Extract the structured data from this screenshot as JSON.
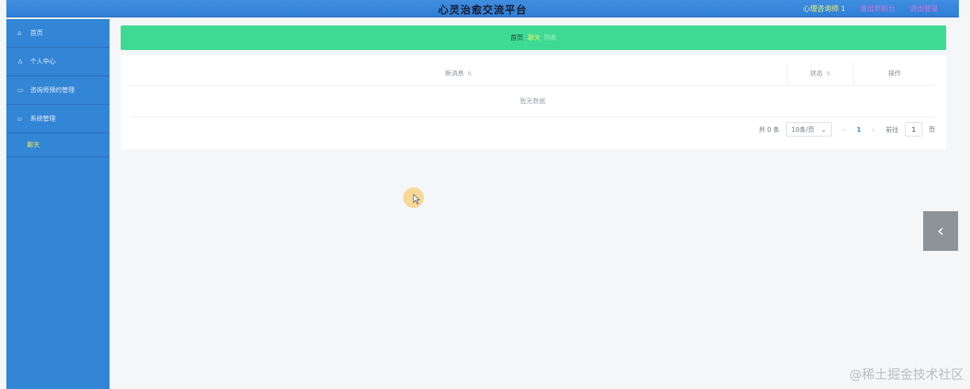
{
  "header": {
    "title": "心灵治愈交流平台",
    "user_label": "心理咨询师 1",
    "link1": "退出到前台",
    "link2": "退出登录"
  },
  "sidebar": {
    "items": [
      {
        "label": "首页",
        "icon": "home-icon"
      },
      {
        "label": "个人中心",
        "icon": "user-icon"
      },
      {
        "label": "咨询师预约管理",
        "icon": "calendar-icon"
      },
      {
        "label": "系统管理",
        "icon": "settings-icon"
      }
    ],
    "sub_item": "聊天"
  },
  "breadcrumb": {
    "home": "首页",
    "current": "聊天",
    "extra": "列表"
  },
  "table": {
    "columns": [
      "新消息",
      "状态",
      "操作"
    ],
    "empty_text": "暂无数据"
  },
  "pagination": {
    "total": "共 0 条",
    "page_size": "10条/页",
    "current_page": "1",
    "goto_label": "前往",
    "goto_value": "1",
    "page_suffix": "页"
  },
  "watermark": "@稀土掘金技术社区"
}
